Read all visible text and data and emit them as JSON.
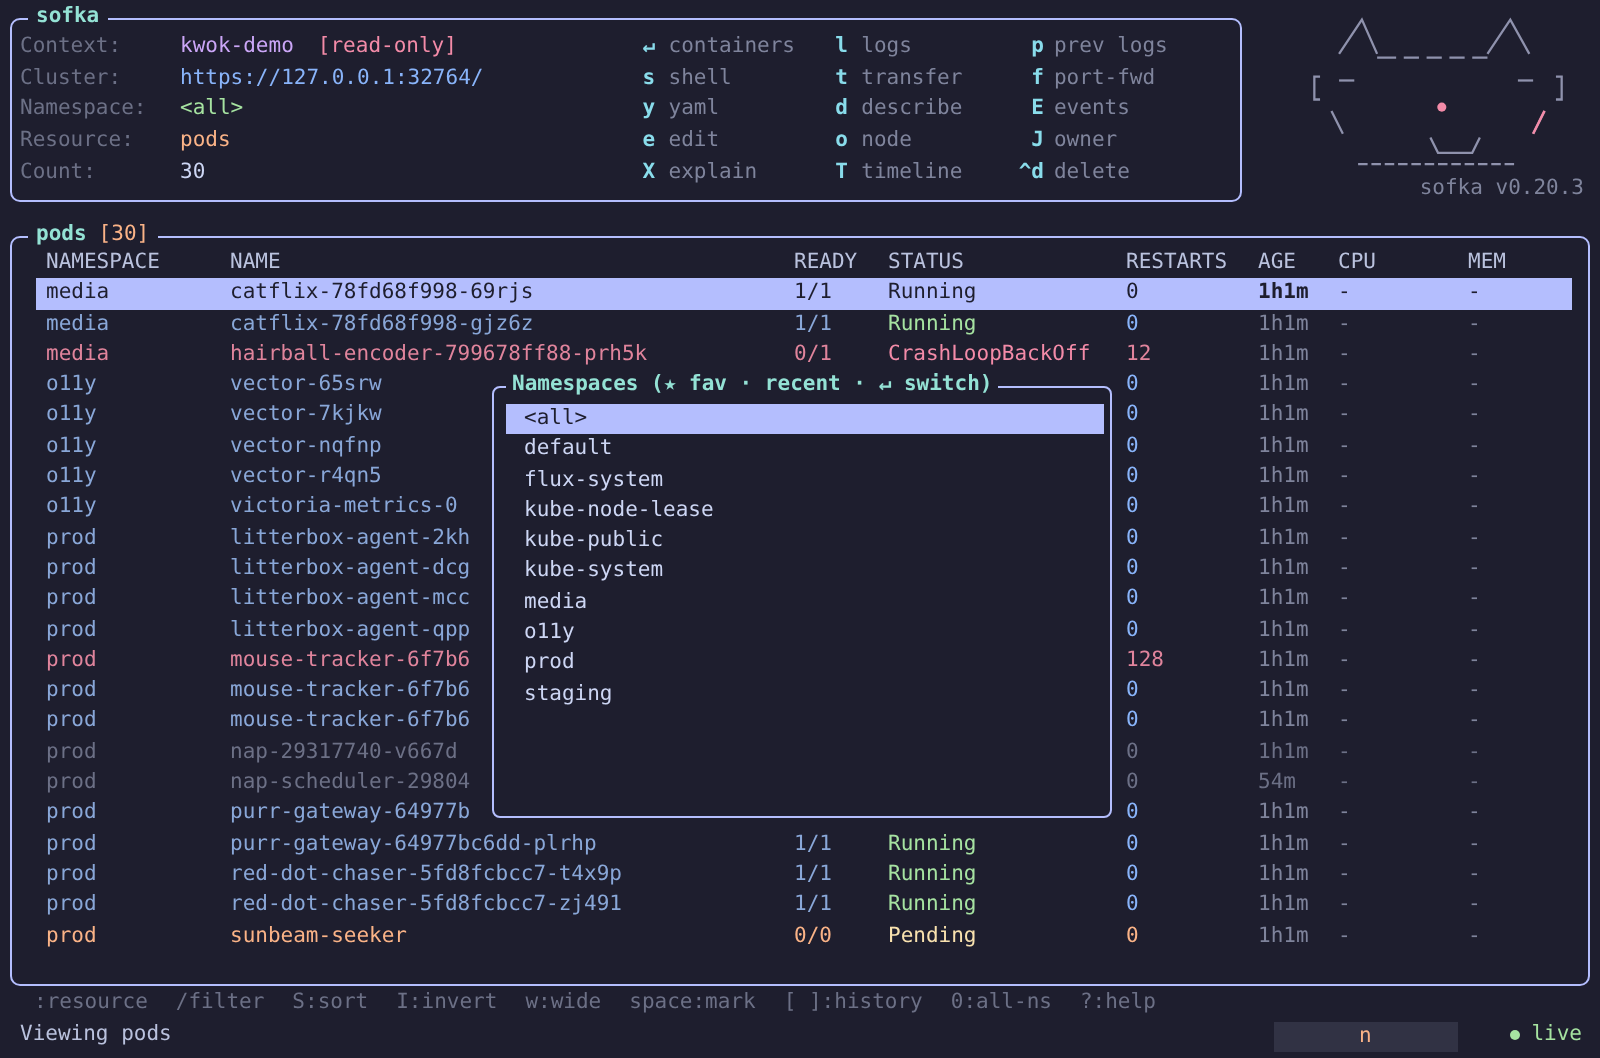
{
  "app": {
    "title": "sofka",
    "version": "sofka v0.20.3"
  },
  "context": [
    {
      "label": "Context:",
      "value": "kwok-demo",
      "kind": "context",
      "badge": "[read-only]"
    },
    {
      "label": "Cluster:",
      "value": "https://127.0.0.1:32764/",
      "kind": "cluster"
    },
    {
      "label": "Namespace:",
      "value": "<all>",
      "kind": "namespace"
    },
    {
      "label": "Resource:",
      "value": "pods",
      "kind": "resource"
    },
    {
      "label": "Count:",
      "value": "30",
      "kind": "count"
    }
  ],
  "shortcuts": [
    [
      {
        "key": "↵",
        "action": "containers"
      },
      {
        "key": "s",
        "action": "shell"
      },
      {
        "key": "y",
        "action": "yaml"
      },
      {
        "key": "e",
        "action": "edit"
      },
      {
        "key": "X",
        "action": "explain"
      }
    ],
    [
      {
        "key": "l",
        "action": "logs"
      },
      {
        "key": "t",
        "action": "transfer"
      },
      {
        "key": "d",
        "action": "describe"
      },
      {
        "key": "o",
        "action": "node"
      },
      {
        "key": "T",
        "action": "timeline"
      }
    ],
    [
      {
        "key": "p",
        "action": "prev logs"
      },
      {
        "key": "f",
        "action": "port-fwd"
      },
      {
        "key": "E",
        "action": "events"
      },
      {
        "key": "J",
        "action": "owner"
      },
      {
        "key": "^d",
        "action": "delete"
      }
    ]
  ],
  "table": {
    "title": "pods",
    "count": "[30]",
    "columns": [
      "NAMESPACE",
      "NAME",
      "READY",
      "STATUS",
      "RESTARTS",
      "AGE",
      "CPU",
      "MEM"
    ],
    "rows": [
      {
        "namespace": "media",
        "name": "catflix-78fd68f998-69rjs",
        "ready": "1/1",
        "status": "Running",
        "restarts": "0",
        "age": "1h1m",
        "cpu": "-",
        "mem": "-",
        "kind": "ok",
        "selected": true
      },
      {
        "namespace": "media",
        "name": "catflix-78fd68f998-gjz6z",
        "ready": "1/1",
        "status": "Running",
        "restarts": "0",
        "age": "1h1m",
        "cpu": "-",
        "mem": "-",
        "kind": "ok",
        "selected": false
      },
      {
        "namespace": "media",
        "name": "hairball-encoder-799678ff88-prh5k",
        "ready": "0/1",
        "status": "CrashLoopBackOff",
        "restarts": "12",
        "age": "1h1m",
        "cpu": "-",
        "mem": "-",
        "kind": "error",
        "selected": false
      },
      {
        "namespace": "o11y",
        "name": "vector-65srw",
        "restarts": "0",
        "age": "1h1m",
        "cpu": "-",
        "mem": "-",
        "kind": "ok",
        "selected": false
      },
      {
        "namespace": "o11y",
        "name": "vector-7kjkw",
        "restarts": "0",
        "age": "1h1m",
        "cpu": "-",
        "mem": "-",
        "kind": "ok",
        "selected": false
      },
      {
        "namespace": "o11y",
        "name": "vector-nqfnp",
        "restarts": "0",
        "age": "1h1m",
        "cpu": "-",
        "mem": "-",
        "kind": "ok",
        "selected": false
      },
      {
        "namespace": "o11y",
        "name": "vector-r4qn5",
        "restarts": "0",
        "age": "1h1m",
        "cpu": "-",
        "mem": "-",
        "kind": "ok",
        "selected": false
      },
      {
        "namespace": "o11y",
        "name": "victoria-metrics-0",
        "restarts": "0",
        "age": "1h1m",
        "cpu": "-",
        "mem": "-",
        "kind": "ok",
        "selected": false
      },
      {
        "namespace": "prod",
        "name": "litterbox-agent-2kh",
        "restarts": "0",
        "age": "1h1m",
        "cpu": "-",
        "mem": "-",
        "kind": "ok",
        "selected": false
      },
      {
        "namespace": "prod",
        "name": "litterbox-agent-dcg",
        "restarts": "0",
        "age": "1h1m",
        "cpu": "-",
        "mem": "-",
        "kind": "ok",
        "selected": false
      },
      {
        "namespace": "prod",
        "name": "litterbox-agent-mcc",
        "restarts": "0",
        "age": "1h1m",
        "cpu": "-",
        "mem": "-",
        "kind": "ok",
        "selected": false
      },
      {
        "namespace": "prod",
        "name": "litterbox-agent-qpp",
        "restarts": "0",
        "age": "1h1m",
        "cpu": "-",
        "mem": "-",
        "kind": "ok",
        "selected": false
      },
      {
        "namespace": "prod",
        "name": "mouse-tracker-6f7b6",
        "restarts": "128",
        "age": "1h1m",
        "cpu": "-",
        "mem": "-",
        "kind": "error",
        "selected": false
      },
      {
        "namespace": "prod",
        "name": "mouse-tracker-6f7b6",
        "restarts": "0",
        "age": "1h1m",
        "cpu": "-",
        "mem": "-",
        "kind": "ok",
        "selected": false
      },
      {
        "namespace": "prod",
        "name": "mouse-tracker-6f7b6",
        "restarts": "0",
        "age": "1h1m",
        "cpu": "-",
        "mem": "-",
        "kind": "ok",
        "selected": false
      },
      {
        "namespace": "prod",
        "name": "nap-29317740-v667d",
        "restarts": "0",
        "age": "1h1m",
        "cpu": "-",
        "mem": "-",
        "kind": "completed",
        "selected": false
      },
      {
        "namespace": "prod",
        "name": "nap-scheduler-29804",
        "restarts": "0",
        "age": "54m",
        "cpu": "-",
        "mem": "-",
        "kind": "completed",
        "selected": false
      },
      {
        "namespace": "prod",
        "name": "purr-gateway-64977b",
        "restarts": "0",
        "age": "1h1m",
        "cpu": "-",
        "mem": "-",
        "kind": "ok",
        "selected": false
      },
      {
        "namespace": "prod",
        "name": "purr-gateway-64977bc6dd-plrhp",
        "ready": "1/1",
        "status": "Running",
        "restarts": "0",
        "age": "1h1m",
        "cpu": "-",
        "mem": "-",
        "kind": "ok",
        "selected": false
      },
      {
        "namespace": "prod",
        "name": "red-dot-chaser-5fd8fcbcc7-t4x9p",
        "ready": "1/1",
        "status": "Running",
        "restarts": "0",
        "age": "1h1m",
        "cpu": "-",
        "mem": "-",
        "kind": "ok",
        "selected": false
      },
      {
        "namespace": "prod",
        "name": "red-dot-chaser-5fd8fcbcc7-zj491",
        "ready": "1/1",
        "status": "Running",
        "restarts": "0",
        "age": "1h1m",
        "cpu": "-",
        "mem": "-",
        "kind": "ok",
        "selected": false
      },
      {
        "namespace": "prod",
        "name": "sunbeam-seeker",
        "ready": "0/0",
        "status": "Pending",
        "restarts": "0",
        "age": "1h1m",
        "cpu": "-",
        "mem": "-",
        "kind": "pending",
        "selected": false
      }
    ]
  },
  "namespace_picker": {
    "title": "Namespaces (★ fav · recent · ↵ switch)",
    "items": [
      {
        "label": "<all>",
        "selected": true
      },
      {
        "label": "default",
        "selected": false
      },
      {
        "label": "flux-system",
        "selected": false
      },
      {
        "label": "kube-node-lease",
        "selected": false
      },
      {
        "label": "kube-public",
        "selected": false
      },
      {
        "label": "kube-system",
        "selected": false
      },
      {
        "label": "media",
        "selected": false
      },
      {
        "label": "o11y",
        "selected": false
      },
      {
        "label": "prod",
        "selected": false
      },
      {
        "label": "staging",
        "selected": false
      }
    ]
  },
  "hints": [
    ":resource",
    "/filter",
    "S:sort",
    "I:invert",
    "w:wide",
    "space:mark",
    "[ ]:history",
    "0:all-ns",
    "?:help"
  ],
  "status_bar": {
    "message": "Viewing pods",
    "input": "n",
    "live": "live"
  }
}
